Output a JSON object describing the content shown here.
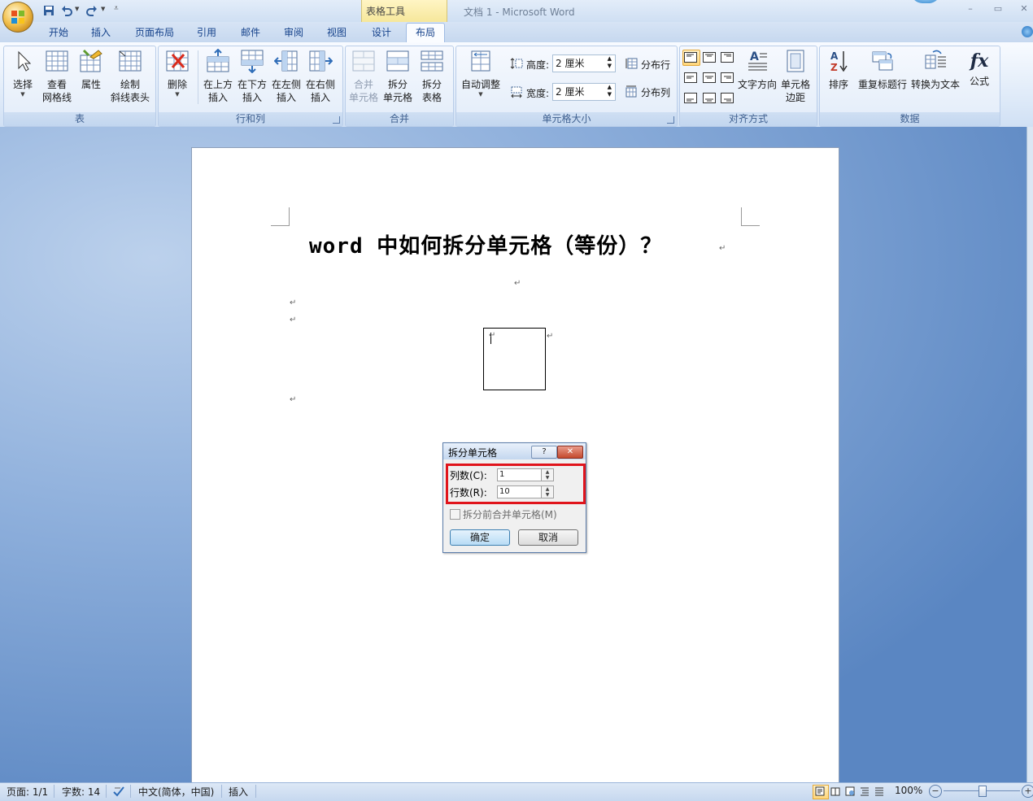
{
  "app": {
    "doc_title": "文档 1 - Microsoft Word",
    "context_group": "表格工具",
    "window_controls": [
      "minimize-icon",
      "restore-icon",
      "close-icon"
    ]
  },
  "qat": {
    "icons": [
      "save-icon",
      "undo-icon",
      "redo-icon",
      "customize-qat-icon"
    ]
  },
  "tabs": [
    "开始",
    "插入",
    "页面布局",
    "引用",
    "邮件",
    "审阅",
    "视图",
    "设计",
    "布局"
  ],
  "active_tab": "布局",
  "ribbon": {
    "groups": {
      "table": "表",
      "rows_cols": "行和列",
      "merge": "合并",
      "cell_size": "单元格大小",
      "alignment": "对齐方式",
      "data": "数据"
    },
    "table_buttons": {
      "select": "选择",
      "gridlines_1": "查看",
      "gridlines_2": "网格线",
      "properties": "属性",
      "draw_1": "绘制",
      "draw_2": "斜线表头"
    },
    "rows_cols_buttons": {
      "delete": "删除",
      "insert_above_1": "在上方",
      "insert_below_1": "在下方",
      "insert_left_1": "在左侧",
      "insert_right_1": "在右侧",
      "insert_2": "插入"
    },
    "merge_buttons": {
      "merge_1": "合并",
      "merge_2": "单元格",
      "split_cells_1": "拆分",
      "split_cells_2": "单元格",
      "split_table_1": "拆分",
      "split_table_2": "表格"
    },
    "cell_size": {
      "autofit": "自动调整",
      "height_label": "高度:",
      "height_value": "2 厘米",
      "width_label": "宽度:",
      "width_value": "2 厘米",
      "distribute_rows": "分布行",
      "distribute_cols": "分布列"
    },
    "alignment": {
      "text_direction": "文字方向",
      "cell_margins_1": "单元格",
      "cell_margins_2": "边距"
    },
    "data": {
      "sort": "排序",
      "repeat_header": "重复标题行",
      "convert_to_text": "转换为文本",
      "formula": "公式"
    }
  },
  "document": {
    "heading": "word 中如何拆分单元格（等份）？"
  },
  "dialog": {
    "title": "拆分单元格",
    "help": "?",
    "cols_label": "列数(C):",
    "cols_value": "1",
    "rows_label": "行数(R):",
    "rows_value": "10",
    "merge_before_split": "拆分前合并单元格(M)",
    "merge_before_split_checked": false,
    "ok": "确定",
    "cancel": "取消"
  },
  "status": {
    "page": "页面: 1/1",
    "words": "字数: 14",
    "language": "中文(简体，中国)",
    "mode": "插入",
    "zoom": "100%"
  },
  "colors": {
    "highlight": "#e0141b",
    "tab_text": "#15428b",
    "context_tab": "#f6e79b"
  }
}
